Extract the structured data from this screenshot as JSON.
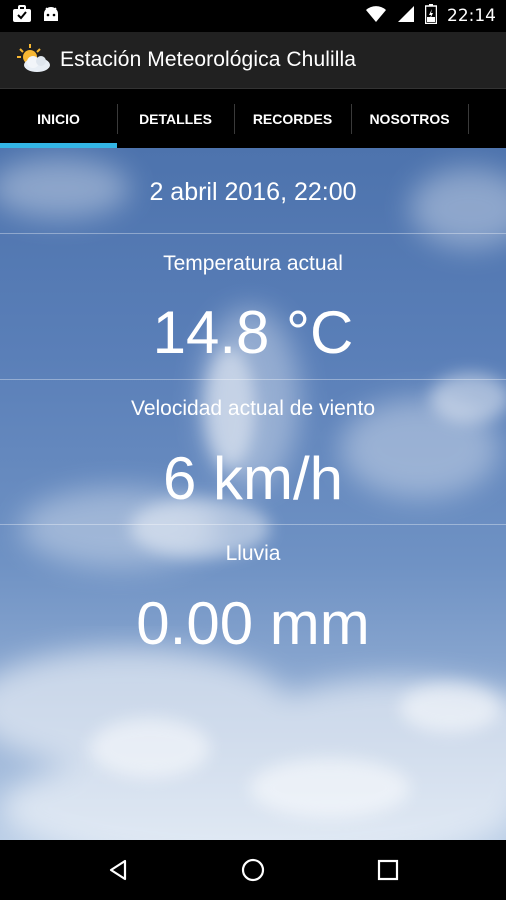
{
  "status_bar": {
    "time": "22:14",
    "left_icons": [
      "briefcase-check-icon",
      "android-icon"
    ],
    "right_icons": [
      "wifi-icon",
      "signal-icon",
      "battery-charging-icon"
    ]
  },
  "app_bar": {
    "title": "Estación Meteorológica Chulilla",
    "icon": "sun-cloud-icon"
  },
  "tabs": [
    {
      "label": "INICIO",
      "active": true
    },
    {
      "label": "DETALLES",
      "active": false
    },
    {
      "label": "RECORDES",
      "active": false
    },
    {
      "label": "NOSOTROS",
      "active": false
    }
  ],
  "colors": {
    "accent": "#33b5e5",
    "app_bar_bg": "#212121",
    "sky_top": "#4d73ad"
  },
  "weather": {
    "datetime": "2 abril 2016, 22:00",
    "temperature_label": "Temperatura actual",
    "temperature_value": "14.8 °C",
    "wind_label": "Velocidad actual de viento",
    "wind_value": "6 km/h",
    "rain_label": "Lluvia",
    "rain_value": "0.00 mm"
  },
  "nav": [
    "back-icon",
    "home-icon",
    "recents-icon"
  ]
}
